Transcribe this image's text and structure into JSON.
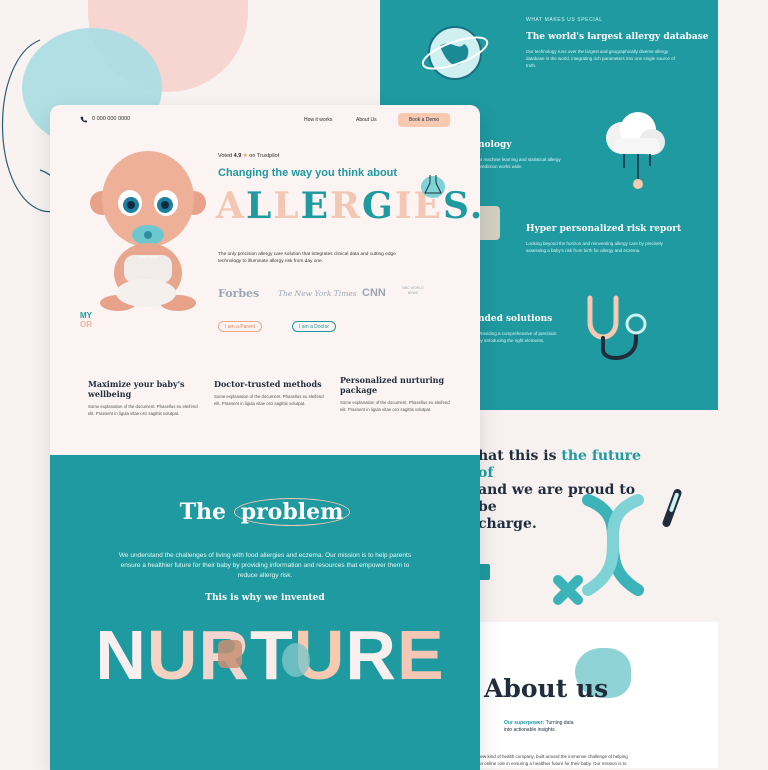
{
  "colors": {
    "teal": "#1e9aa0",
    "peach": "#f6c9b0",
    "navy": "#1f2d3d",
    "pink": "#f7d6d1",
    "cream": "#fbf4f2"
  },
  "header": {
    "phone": "0 000 000 0000",
    "nav": [
      "How it works",
      "About Us"
    ],
    "cta": "Book a Demo"
  },
  "hero": {
    "voted_prefix": "Voted",
    "rating": "4.9",
    "voted_suffix": "on Trustpilot",
    "headline": "Changing the way you think about",
    "big_word_letters": [
      "A",
      "L",
      "L",
      "E",
      "R",
      "G",
      "I",
      "E",
      "S",
      "."
    ],
    "copy": "The only precision allergy care solution that integrates clinical data and cutting edge technology to illuminate allergy risk from day one.",
    "press_logos": [
      "Forbes",
      "The New York Times",
      "CNN",
      "BBC WORLD NEWS"
    ],
    "brand_lines": [
      "MY",
      "OR"
    ],
    "buttons": [
      "I am a Parent",
      "I am a Doctor"
    ],
    "pacifier_text": "baby nurture"
  },
  "features": [
    {
      "title": "Maximize your baby's wellbeing",
      "copy": "Some explanation of the document. Phasellus eu eleifend elit. Praesent in ligula vitae orci sagittis volutpat."
    },
    {
      "title": "Doctor-trusted methods",
      "copy": "Some explanation of the document. Phasellus eu eleifend elit. Praesent in ligula vitae orci sagittis volutpat."
    },
    {
      "title": "Personalized nurturing package",
      "copy": "Some explanation of the document. Phasellus eu eleifend elit. Praesent in ligula vitae orci sagittis volutpat."
    }
  ],
  "problem": {
    "title_a": "The",
    "title_b": "problem",
    "copy": "We understand the challenges of living with food allergies and eczema. Our mission is to help parents ensure a healthier future for their baby by providing information and resources that empower them to reduce allergy risk.",
    "invented": "This is why we invented",
    "nurture_letters": [
      "N",
      "U",
      "R",
      "T",
      "U",
      "R",
      "E"
    ]
  },
  "back": {
    "kicker": "WHAT MAKES US SPECIAL",
    "database_title": "The world's largest allergy database",
    "database_copy": "Our technology runs over the largest and geographically diverse allergy database in the world, integrating rich parameters into one single source of truth.",
    "tech_title": "nology",
    "tech_copy": "AI machine learning and statistical allergy prediction works wide.",
    "risk_title": "Hyper personalized risk report",
    "risk_copy": "Looking beyond the horizon and reinventing allergy care by precisely assessing a baby's risk from birth for allergy and eczema.",
    "solutions_title": "nded solutions",
    "solutions_copy": "Providing a comprehensive of precision by introducing the right elements.",
    "quote_a": "hat this is ",
    "quote_hl": "the future of",
    "quote_b": " and we are proud to be",
    "quote_c": "charge.",
    "about_title": "About us",
    "superpower_label": "Our superpower:",
    "superpower_text": "Turning data into actionable insights.",
    "about_copy_1": "new kind of health company, built around the immense challenge of helping",
    "about_copy_2": "an online role in ensuring a healthier future for their baby. Our mission is to"
  }
}
